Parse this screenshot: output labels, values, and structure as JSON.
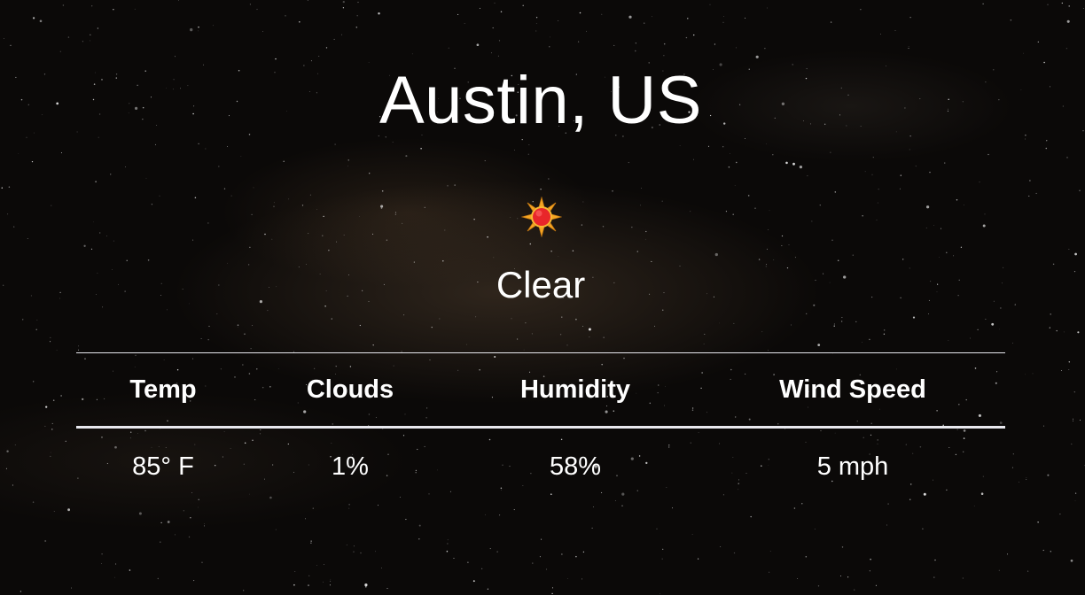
{
  "location": {
    "city": "Austin, US"
  },
  "current": {
    "icon": "sun-icon",
    "condition": "Clear"
  },
  "stats": {
    "headers": [
      "Temp",
      "Clouds",
      "Humidity",
      "Wind Speed"
    ],
    "values": [
      "85° F",
      "1%",
      "58%",
      "5 mph"
    ]
  },
  "colors": {
    "background": "#0b0908",
    "text": "#ffffff",
    "divider": "#e8e8ee",
    "sun_core": "#e8262a",
    "sun_rays": "#f5a623"
  }
}
